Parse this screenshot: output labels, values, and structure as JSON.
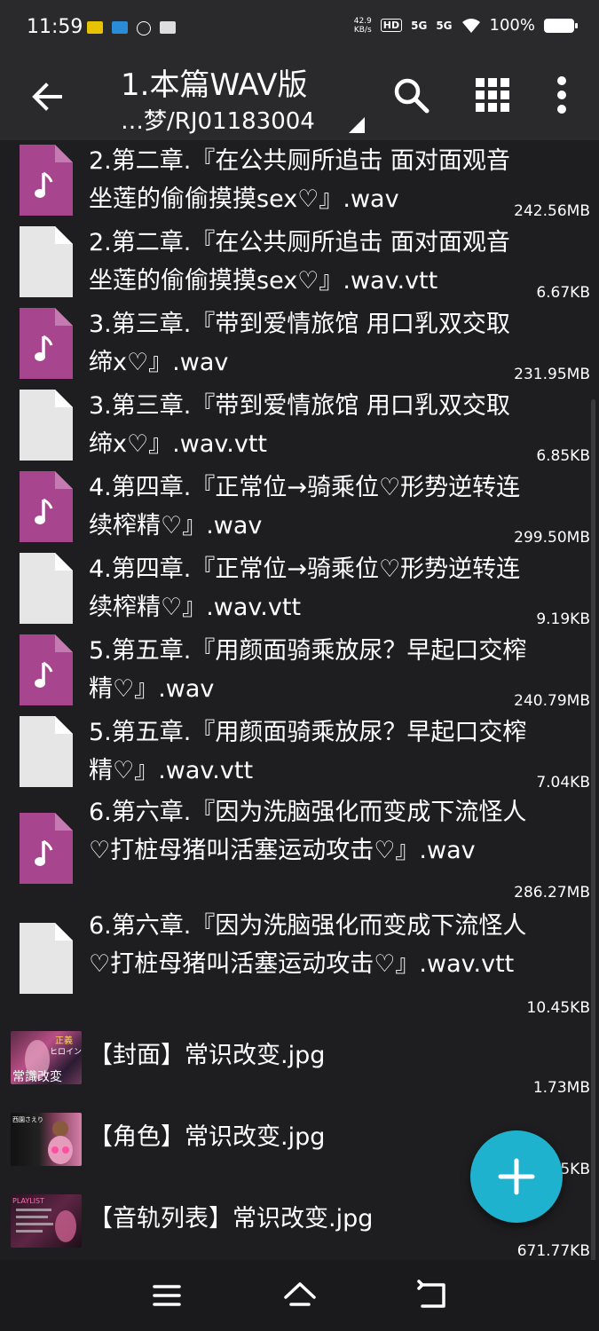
{
  "status_bar": {
    "time": "11:59",
    "net_speed_value": "42.9",
    "net_speed_unit": "KB/s",
    "hd_badge": "HD",
    "signal1": "5G",
    "signal2": "5G",
    "battery": "100%"
  },
  "app_bar": {
    "title": "1.本篇WAV版",
    "path": "…梦/RJ01183004"
  },
  "files": [
    {
      "name": "2.第二章.『在公共厕所追击 面对面观音坐莲的偷偷摸摸sex♡』.wav",
      "size": "242.56MB",
      "type": "audio"
    },
    {
      "name": "2.第二章.『在公共厕所追击 面对面观音坐莲的偷偷摸摸sex♡』.wav.vtt",
      "size": "6.67KB",
      "type": "text"
    },
    {
      "name": "3.第三章.『带到爱情旅馆 用口乳双交取缔x♡』.wav",
      "size": "231.95MB",
      "type": "audio"
    },
    {
      "name": "3.第三章.『带到爱情旅馆 用口乳双交取缔x♡』.wav.vtt",
      "size": "6.85KB",
      "type": "text"
    },
    {
      "name": "4.第四章.『正常位→骑乘位♡形势逆转连续榨精♡』.wav",
      "size": "299.50MB",
      "type": "audio"
    },
    {
      "name": "4.第四章.『正常位→骑乘位♡形势逆转连续榨精♡』.wav.vtt",
      "size": "9.19KB",
      "type": "text"
    },
    {
      "name": "5.第五章.『用颜面骑乘放尿？早起口交榨精♡』.wav",
      "size": "240.79MB",
      "type": "audio"
    },
    {
      "name": "5.第五章.『用颜面骑乘放尿？早起口交榨精♡』.wav.vtt",
      "size": "7.04KB",
      "type": "text"
    },
    {
      "name": "6.第六章.『因为洗脑强化而变成下流怪人♡打桩母猪叫活塞运动攻击♡』.wav",
      "size": "286.27MB",
      "type": "audio"
    },
    {
      "name": "6.第六章.『因为洗脑强化而变成下流怪人♡打桩母猪叫活塞运动攻击♡』.wav.vtt",
      "size": "10.45KB",
      "type": "text"
    },
    {
      "name": "【封面】常识改变.jpg",
      "size": "1.73MB",
      "type": "image",
      "thumb_text_a": "正義",
      "thumb_text_b": "ヒロイン",
      "thumb_text_c": "常識改変"
    },
    {
      "name": "【角色】常识改变.jpg",
      "size": "5KB",
      "type": "image",
      "thumb_text_a": "西園さえり"
    },
    {
      "name": "【音轨列表】常识改变.jpg",
      "size": "671.77KB",
      "type": "image",
      "thumb_text_a": "PLAYLIST"
    }
  ],
  "colors": {
    "audio_icon": "#a7468f",
    "text_icon": "#e6e6e6",
    "fab": "#1fb2cf",
    "background": "#1e1e20"
  },
  "icons": {
    "back": "arrow-left-icon",
    "search": "search-icon",
    "grid": "grid-view-icon",
    "more": "more-vert-icon",
    "fab": "plus-icon"
  }
}
